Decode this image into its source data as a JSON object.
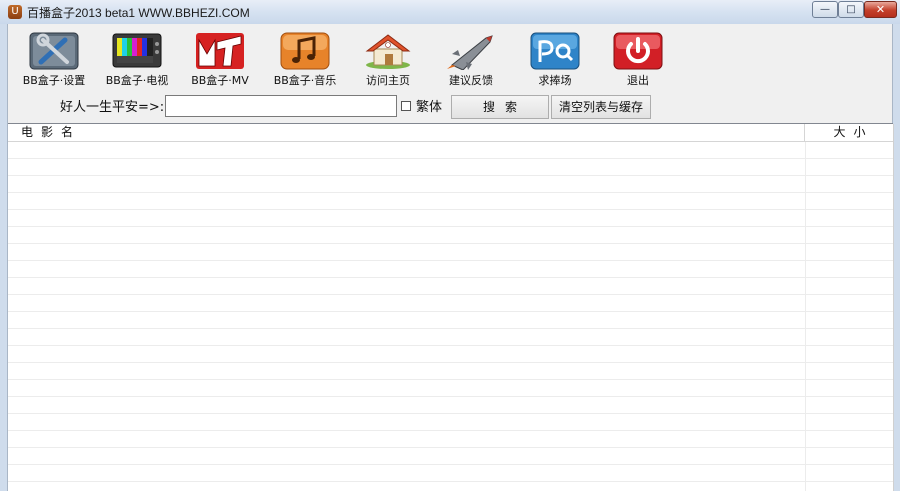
{
  "window": {
    "title": "百播盒子2013 beta1  WWW.BBHEZI.COM",
    "icon": "app-logo-icon",
    "controls": {
      "minimize": "—",
      "maximize": "□",
      "close": "✕"
    }
  },
  "toolbar": {
    "items": [
      {
        "label": "BB盒子·设置",
        "icon": "tools-icon"
      },
      {
        "label": "BB盒子·电视",
        "icon": "tv-icon"
      },
      {
        "label": "BB盒子·MV",
        "icon": "mtv-icon"
      },
      {
        "label": "BB盒子·音乐",
        "icon": "music-note-icon"
      },
      {
        "label": "访问主页",
        "icon": "home-icon"
      },
      {
        "label": "建议反馈",
        "icon": "rocket-icon"
      },
      {
        "label": "求捧场",
        "icon": "search-logo-icon"
      },
      {
        "label": "退出",
        "icon": "power-icon"
      }
    ]
  },
  "search": {
    "label": "好人一生平安=>:",
    "value": "",
    "traditional_label": "繁体",
    "traditional_checked": false,
    "search_button": "搜索",
    "clear_button": "清空列表与缓存"
  },
  "list": {
    "columns": [
      "电影名",
      "大小"
    ],
    "rows": []
  },
  "colors": {
    "titlebar": "#d6e2f1",
    "client_bg": "#f0f0f0",
    "close_button": "#c4402b"
  }
}
